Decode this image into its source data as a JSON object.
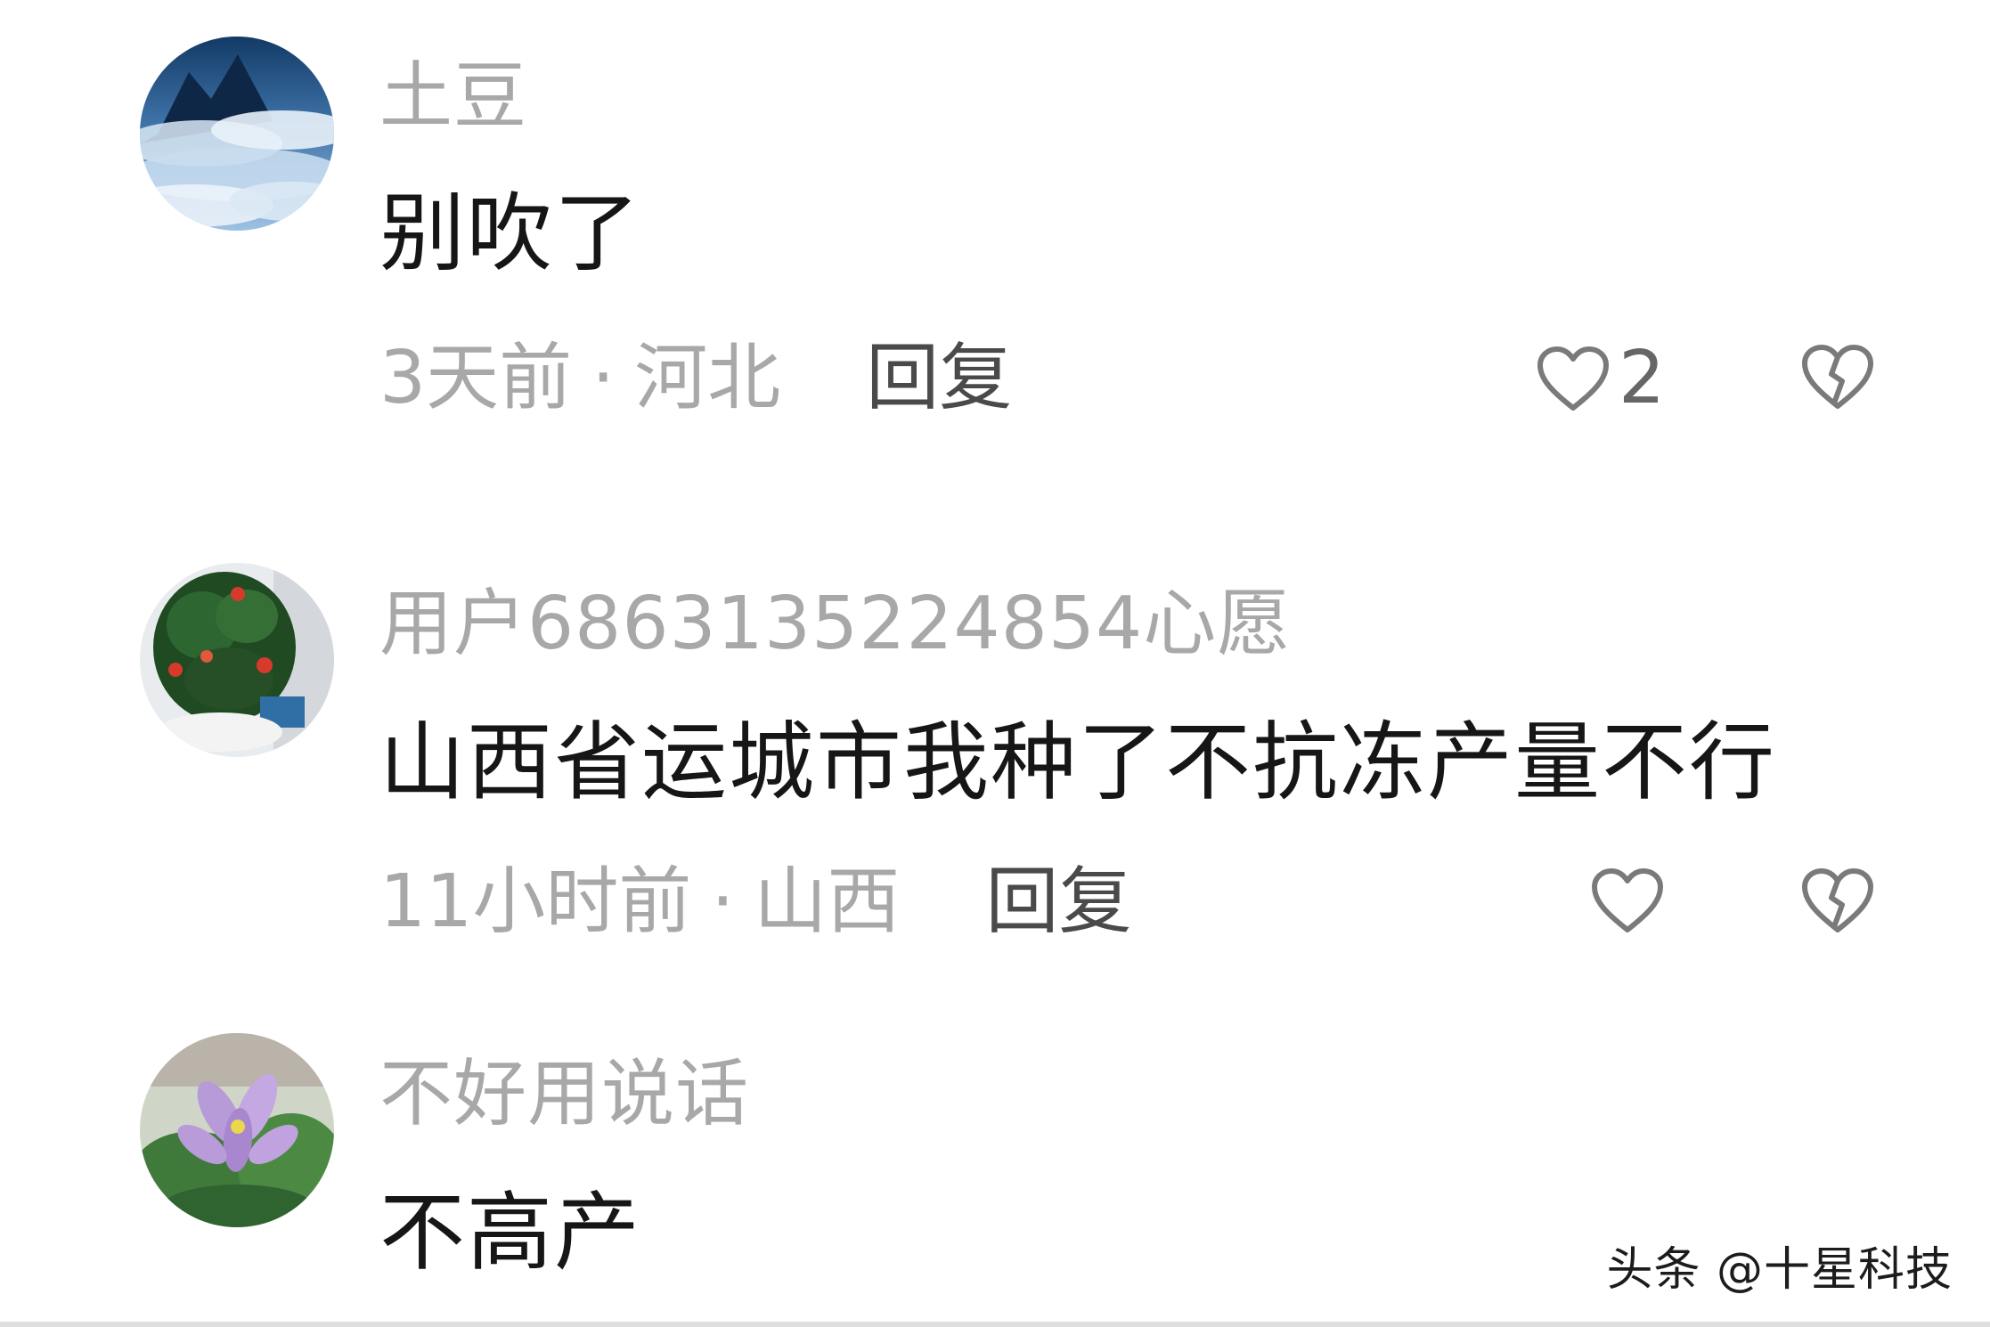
{
  "comments": [
    {
      "avatar_icon": "sea-of-clouds-avatar",
      "username": "土豆",
      "text": "别吹了",
      "time": "3天前",
      "separator": "·",
      "location": "河北",
      "reply_label": "回复",
      "like_icon": "heart-outline-icon",
      "like_count": "2",
      "dislike_icon": "broken-heart-icon"
    },
    {
      "avatar_icon": "potted-plant-avatar",
      "username": "用户6863135224854心愿",
      "text": "山西省运城市我种了不抗冻产量不行",
      "time": "11小时前",
      "separator": "·",
      "location": "山西",
      "reply_label": "回复",
      "like_icon": "heart-outline-icon",
      "dislike_icon": "broken-heart-icon"
    },
    {
      "avatar_icon": "purple-flower-avatar",
      "username": "不好用说话",
      "text": "不高产"
    }
  ],
  "watermark": "头条 @十星科技",
  "colors": {
    "username": "#a8a8a8",
    "text": "#161616",
    "meta": "#a8a8a8",
    "reply": "#4a4a4a",
    "icon": "#7a7a7a"
  }
}
